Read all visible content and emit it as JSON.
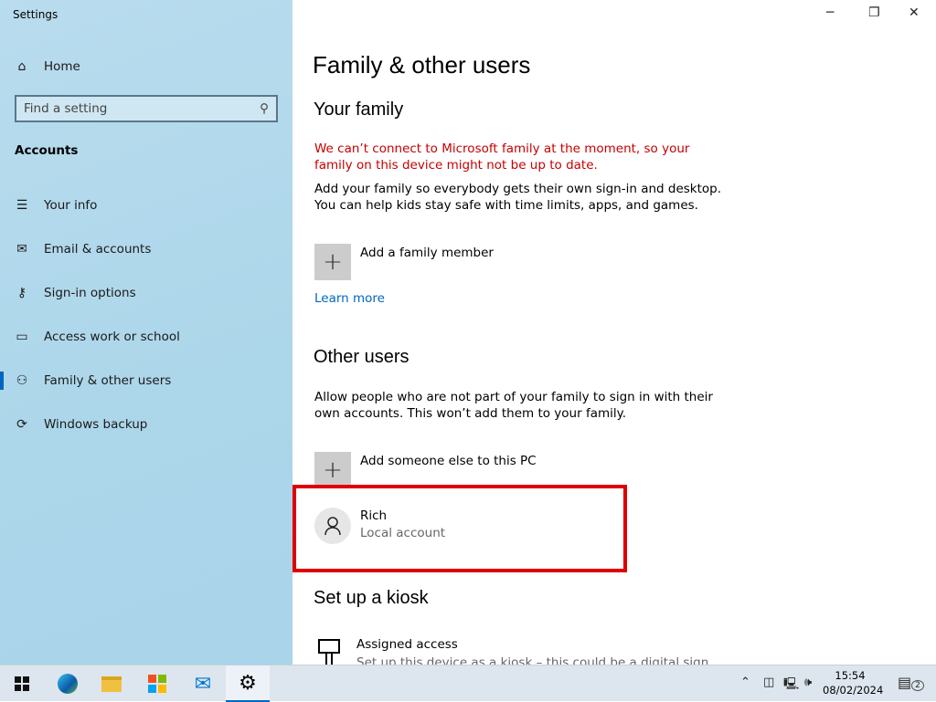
{
  "window": {
    "title": "Settings"
  },
  "sidebar": {
    "home": "Home",
    "search_placeholder": "Find a setting",
    "section": "Accounts",
    "items": [
      {
        "label": "Your info",
        "icon": "contact-card-icon"
      },
      {
        "label": "Email & accounts",
        "icon": "mail-icon"
      },
      {
        "label": "Sign-in options",
        "icon": "key-icon"
      },
      {
        "label": "Access work or school",
        "icon": "briefcase-icon"
      },
      {
        "label": "Family & other users",
        "icon": "person-add-icon",
        "active": true
      },
      {
        "label": "Windows backup",
        "icon": "sync-icon"
      }
    ]
  },
  "main": {
    "title": "Family & other users",
    "family": {
      "heading": "Your family",
      "error": "We can’t connect to Microsoft family at the moment, so your family on this device might not be up to date.",
      "description": "Add your family so everybody gets their own sign-in and desktop. You can help kids stay safe with time limits, apps, and games.",
      "add_label": "Add a family member",
      "learn_more": "Learn more"
    },
    "other": {
      "heading": "Other users",
      "description": "Allow people who are not part of your family to sign in with their own accounts. This won’t add them to your family.",
      "add_label": "Add someone else to this PC",
      "user_name": "Rich",
      "user_type": "Local account"
    },
    "kiosk": {
      "heading": "Set up a kiosk",
      "item_title": "Assigned access",
      "item_desc": "Set up this device as a kiosk – this could be a digital sign..."
    }
  },
  "taskbar": {
    "time": "15:54",
    "date": "08/02/2024",
    "notifications": "2",
    "highlight_color": "#e00000"
  }
}
